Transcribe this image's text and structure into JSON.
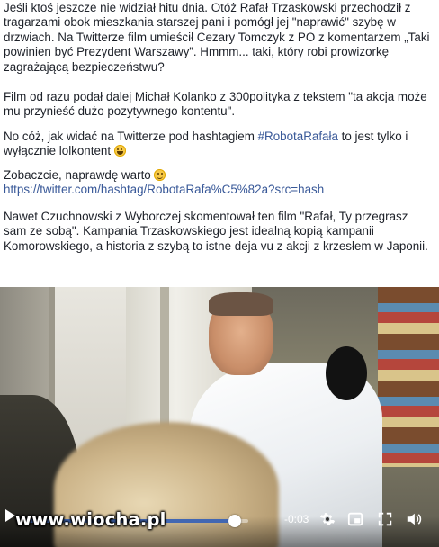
{
  "post": {
    "p1": "Jeśli ktoś jeszcze nie widział hitu dnia. Otóż Rafał Trzaskowski przechodził z tragarzami obok mieszkania starszej pani i pomógł jej \"naprawić\" szybę w drzwiach. Na Twitterze film umieścił Cezary Tomczyk z PO z komentarzem „Taki powinien być Prezydent Warszawy”. Hmmm... taki, który robi prowizorkę zagrażającą bezpieczeństwu?",
    "p2": "Film od razu podał dalej Michał Kolanko z 300polityka z tekstem \"ta akcja może mu przynieść dużo pozytywnego kontentu\".",
    "p3_before": "No cóż, jak widać na Twitterze pod hashtagiem ",
    "p3_hashtag": "#RobotaRafała",
    "p3_after": " to jest tylko i wyłącznie lolkontent ",
    "p4_text": "Zobaczcie, naprawdę warto ",
    "p4_link": "https://twitter.com/hashtag/RobotaRafa%C5%82a?src=hash",
    "p5": "Nawet Czuchnowski z Wyborczej skomentował ten film \"Rafał, Ty przegrasz sam ze sobą\". Kampania Trzaskowskiego jest idealną kopią kampanii Komorowskiego, a historia z szybą to istne deja vu z akcji z krzesłem w Japonii."
  },
  "video": {
    "time_remaining": "-0:03",
    "progress_fraction": 0.94,
    "watermark": "www.wiocha.pl",
    "icons": [
      "play-icon",
      "settings-gear-icon",
      "picture-in-picture-icon",
      "fullscreen-icon",
      "volume-icon"
    ]
  },
  "colors": {
    "link": "#385898",
    "progress": "#4267b2",
    "text": "#1d2129"
  }
}
